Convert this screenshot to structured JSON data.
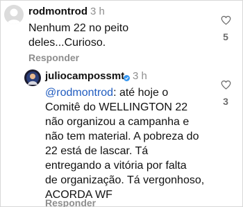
{
  "comments": [
    {
      "username": "rodmontrod",
      "time": "3 h",
      "lines": [
        "Nenhum 22 no peito",
        "deles...Curioso."
      ],
      "reply_label": "Responder",
      "like_count": "5",
      "like_icon": "heart-outline-icon"
    },
    {
      "username": "juliocampossmt",
      "verified": true,
      "time": "3 h",
      "mention": "@rodmontrod",
      "lines": [
        ": até hoje o",
        "Comitê do WELLINGTON 22",
        "não organizou a campanha e",
        "não tem material. A pobreza do",
        "22 está de lascar. Tá",
        "entregando a vitória por falta",
        "de organização. Tá vergonhoso,",
        "ACORDA WF"
      ],
      "reply_label": "Responder",
      "like_count": "3",
      "like_icon": "heart-outline-icon"
    }
  ],
  "colors": {
    "mention": "#1f5bbf",
    "verified": "#3897f0",
    "muted": "#8e8e8e"
  }
}
